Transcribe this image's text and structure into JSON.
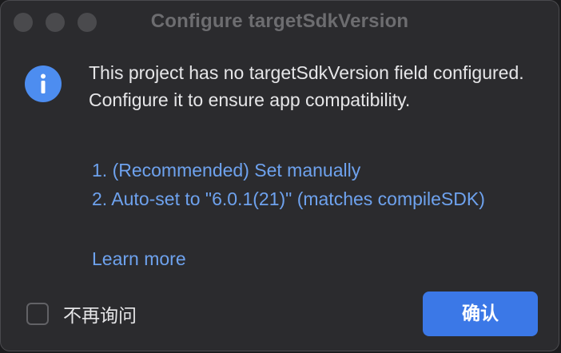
{
  "window": {
    "title": "Configure targetSdkVersion",
    "traffic_lights": [
      "close",
      "minimize",
      "zoom"
    ]
  },
  "dialog": {
    "icon": "info-icon",
    "message": "This project has no targetSdkVersion field configured. Configure it to ensure app compatibility.",
    "options": [
      "1. (Recommended) Set manually",
      "2. Auto-set to \"6.0.1(21)\" (matches compileSDK)"
    ],
    "learn_more": "Learn more",
    "dont_ask_again": {
      "label": "不再询问",
      "checked": false
    },
    "confirm_label": "确认"
  },
  "colors": {
    "background": "#2b2b2e",
    "accent": "#3b78e7",
    "link": "#6ea2ee",
    "info_icon": "#4d8df0",
    "text": "#e6e6e8",
    "title_text": "#6d6d70"
  }
}
